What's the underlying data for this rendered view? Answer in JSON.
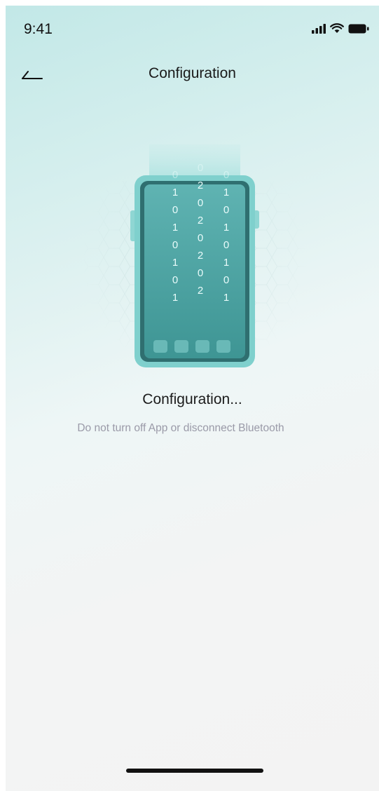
{
  "status_bar": {
    "time": "9:41",
    "icons": [
      "signal-icon",
      "wifi-icon",
      "battery-icon"
    ]
  },
  "nav": {
    "title": "Configuration",
    "back_icon": "back-arrow-icon"
  },
  "illustration": {
    "icon": "phone-firmware-update-icon",
    "code_columns": [
      [
        "0",
        "1",
        "0",
        "1",
        "0",
        "1",
        "0",
        "1"
      ],
      [
        "0",
        "2",
        "0",
        "2",
        "0",
        "2",
        "0",
        "2"
      ],
      [
        "0",
        "1",
        "0",
        "1",
        "0",
        "1",
        "0",
        "1"
      ]
    ],
    "colors": {
      "phone_body": "#7fd0cd",
      "phone_screen": "#4aa3a2",
      "phone_frame": "#2f6f70",
      "accent": "#9fdedb"
    }
  },
  "main": {
    "status_text": "Configuration...",
    "hint_text": "Do not turn off App or disconnect Bluetooth"
  }
}
